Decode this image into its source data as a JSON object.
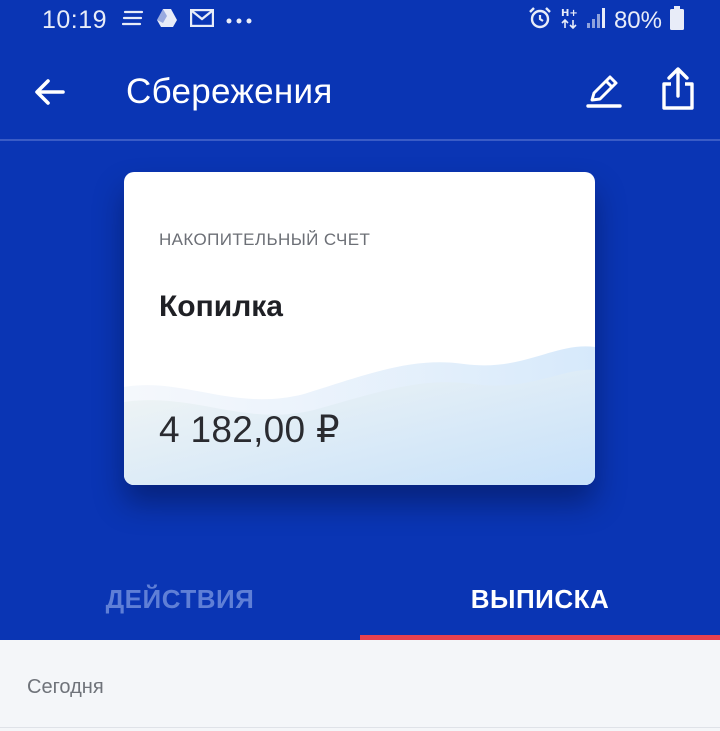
{
  "status_bar": {
    "time": "10:19",
    "battery": "80%",
    "notification_icons": [
      "notes-icon",
      "drive-icon",
      "mail-icon",
      "more-dots-icon"
    ],
    "system_icons": [
      "alarm-icon",
      "hplus-data-icon",
      "signal-icon",
      "battery-icon"
    ]
  },
  "app_bar": {
    "title": "Сбережения",
    "back_icon": "arrow-left-icon",
    "edit_icon": "pencil-icon",
    "share_icon": "share-icon"
  },
  "card": {
    "type_label": "НАКОПИТЕЛЬНЫЙ СЧЕТ",
    "name": "Копилка",
    "balance": "4 182,00 ₽"
  },
  "tabs": [
    {
      "label": "ДЕЙСТВИЯ",
      "active": false
    },
    {
      "label": "ВЫПИСКА",
      "active": true
    }
  ],
  "content": {
    "section_label": "Сегодня"
  },
  "colors": {
    "background": "#0a35b4",
    "tab_indicator": "#e8414f",
    "content_bg": "#f4f6f9"
  }
}
